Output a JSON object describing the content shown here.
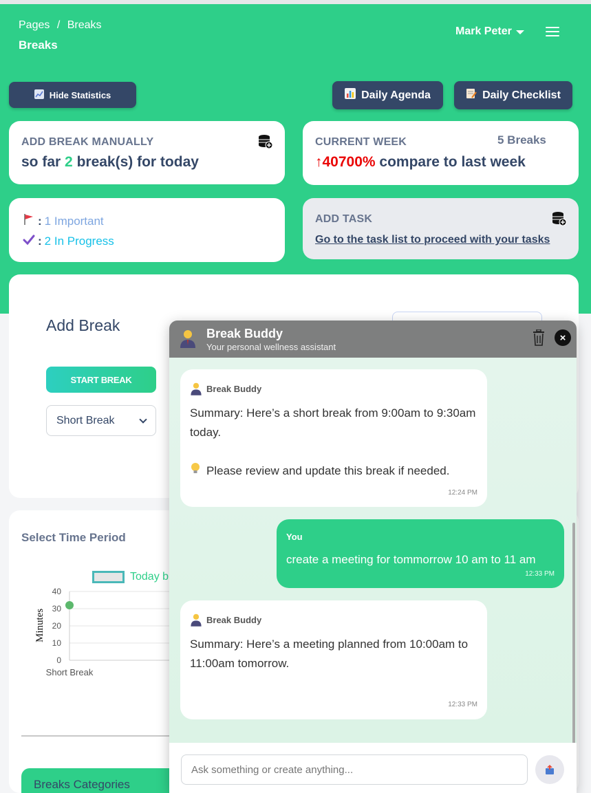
{
  "header": {
    "breadcrumb_root": "Pages",
    "breadcrumb_sep": "/",
    "breadcrumb_current": "Breaks",
    "page_title": "Breaks",
    "user_name": "Mark Peter"
  },
  "toolbar": {
    "hide_stats": "Hide Statistics",
    "daily_agenda": "Daily Agenda",
    "daily_checklist": "Daily Checklist"
  },
  "cards": {
    "add_break": {
      "label": "ADD BREAK MANUALLY",
      "prefix": "so far",
      "count": "2",
      "suffix": "break(s) for today"
    },
    "current_week": {
      "label": "CURRENT WEEK",
      "breaks": "5 Breaks",
      "arrow": "↑",
      "percent": "40700%",
      "compare": "compare to last week"
    },
    "status": {
      "important": "1 Important",
      "in_progress": "2 In Progress"
    },
    "add_task": {
      "label": "ADD TASK",
      "link": "Go to the task list to proceed with your tasks"
    }
  },
  "add_break": {
    "title": "Add Break",
    "start_button": "START BREAK",
    "break_type": "Short Break"
  },
  "period": {
    "title": "Select Time Period",
    "legend": "Today b",
    "categories_button": "Breaks Categories"
  },
  "chart_data": {
    "type": "scatter",
    "categories": [
      "Short Break"
    ],
    "series": [
      {
        "name": "Today b",
        "values": [
          32
        ]
      }
    ],
    "ylabel": "Minutes",
    "ylim": [
      0,
      40
    ],
    "yticks": [
      "40",
      "30",
      "20",
      "10",
      "0"
    ],
    "xticks": [
      "Short Break"
    ]
  },
  "chat": {
    "name": "Break Buddy",
    "subtitle": "Your personal wellness assistant",
    "input_placeholder": "Ask something or create anything...",
    "messages": [
      {
        "sender": "Break Buddy",
        "text": "Summary: Here’s a short break from 9:00am to 9:30am today.",
        "note": "Please review and update this break if needed.",
        "time": "12:24 PM"
      },
      {
        "sender": "You",
        "text": "create a meeting for tommorrow 10 am to 11 am",
        "time": "12:33 PM"
      },
      {
        "sender": "Break Buddy",
        "text": "Summary: Here’s a meeting planned from 10:00am to 11:00am tomorrow.",
        "time": "12:33 PM"
      }
    ]
  },
  "colors": {
    "brand_green": "#2ecf89",
    "dark_button": "#344767",
    "alert_red": "#ea0606",
    "link_blue": "#7ea6e0",
    "info_cyan": "#17c1e8"
  }
}
